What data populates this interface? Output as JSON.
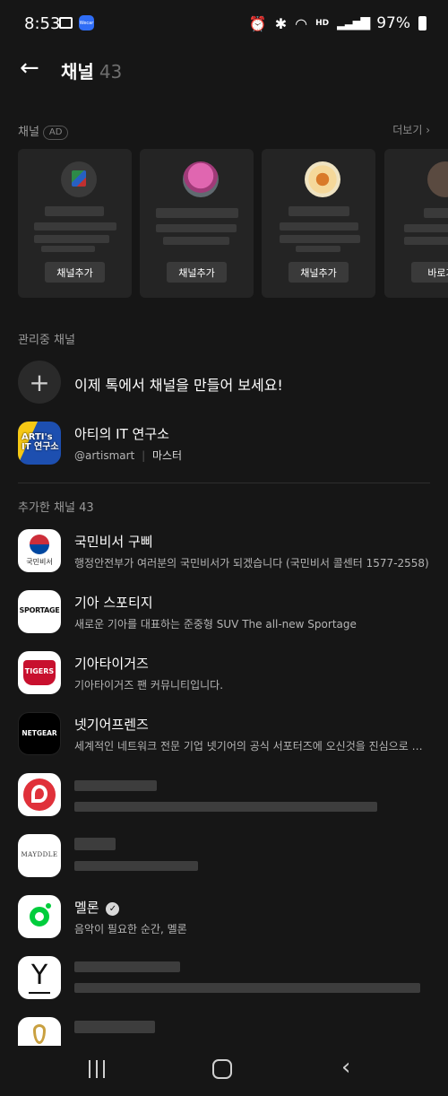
{
  "status_bar": {
    "time": "8:53",
    "wecar_label": "Wecar",
    "hd_label": "HD",
    "battery": "97%"
  },
  "header": {
    "title": "채널",
    "count": "43"
  },
  "ad_section": {
    "label": "채널",
    "ad_badge": "AD",
    "more_label": "더보기",
    "cards": [
      {
        "button_label": "채널추가"
      },
      {
        "button_label": "채널추가"
      },
      {
        "button_label": "채널추가"
      },
      {
        "button_label": "바로가"
      }
    ]
  },
  "managed_section": {
    "label": "관리중 채널",
    "create_prompt": "이제 톡에서 채널을 만들어 보세요!",
    "channel": {
      "name": "아티의 IT 연구소",
      "handle": "@artismart",
      "role": "마스터",
      "logo_text_1": "ARTI's",
      "logo_text_2": "IT 연구소"
    }
  },
  "added_section": {
    "label": "추가한 채널 43",
    "items": [
      {
        "name": "국민비서 구삐",
        "desc": "행정안전부가 여러분의 국민비서가 되겠습니다 (국민비서 콜센터 1577-2558)",
        "logo_text": "국민비서"
      },
      {
        "name": "기아 스포티지",
        "desc": "새로운 기아를 대표하는 준중형 SUV The all-new Sportage",
        "logo_text": "SPORTAGE"
      },
      {
        "name": "기아타이거즈",
        "desc": "기아타이거즈 팬 커뮤니티입니다.",
        "logo_text": "TIGERS"
      },
      {
        "name": "넷기어프렌즈",
        "desc": "세계적인 네트워크 전문 기업 넷기어의 공식 서포터즈에 오신것을 진심으로 환영합니다",
        "logo_text": "NETGEAR"
      },
      {
        "name": "",
        "desc": "",
        "logo_text": ""
      },
      {
        "name": "",
        "desc": "",
        "logo_text": "MAYDDLE"
      },
      {
        "name": "멜론",
        "desc": "음악이 필요한 순간, 멜론",
        "logo_text": ""
      },
      {
        "name": "",
        "desc": "",
        "logo_text": "Y"
      },
      {
        "name": "",
        "desc": "",
        "logo_text": ""
      }
    ]
  },
  "colors": {
    "background": "#161616",
    "melon_green": "#00cd3c",
    "arti_blue": "#1d4fb0",
    "arti_yellow": "#f6c814"
  }
}
